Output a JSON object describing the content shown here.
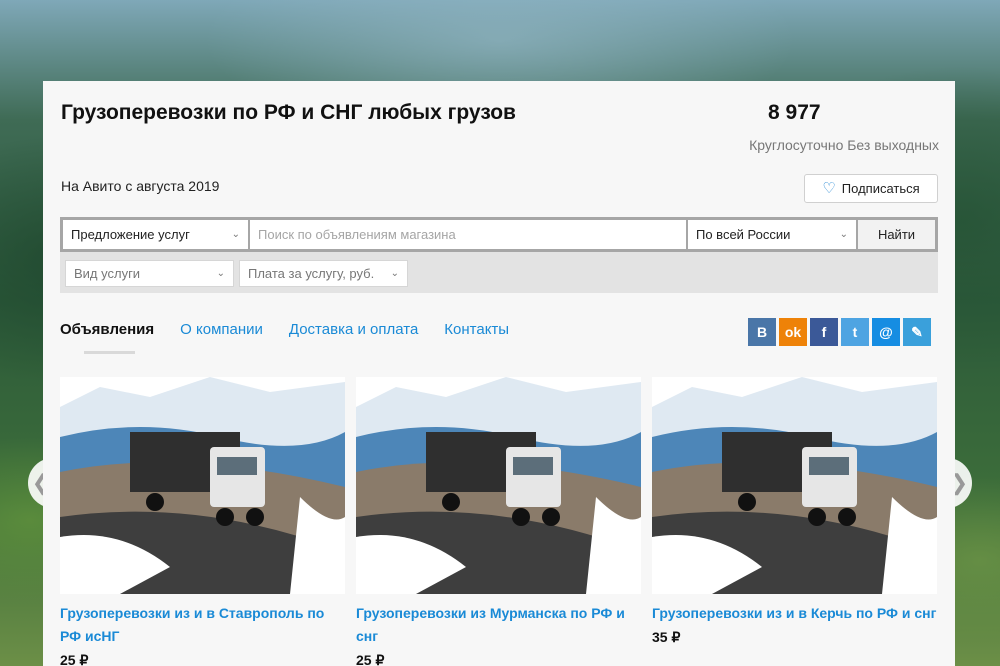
{
  "shop": {
    "title": "Грузоперевозки по РФ и СНГ любых грузов",
    "phone": "8 977",
    "hours": "Круглосуточно Без выходных",
    "since": "На Авито с августа 2019",
    "subscribe_label": "Подписаться"
  },
  "search": {
    "category": "Предложение услуг",
    "query_placeholder": "Поиск по объявлениям магазина",
    "region": "По всей России",
    "find_label": "Найти",
    "service_type": "Вид услуги",
    "price_filter": "Плата за услугу, руб."
  },
  "tabs": [
    {
      "label": "Объявления",
      "active": true
    },
    {
      "label": "О компании",
      "active": false
    },
    {
      "label": "Доставка и оплата",
      "active": false
    },
    {
      "label": "Контакты",
      "active": false
    }
  ],
  "socials": [
    {
      "name": "vk-icon",
      "glyph": "В",
      "color": "#4a76a8"
    },
    {
      "name": "odnoklassniki-icon",
      "glyph": "ok",
      "color": "#ee8208"
    },
    {
      "name": "facebook-icon",
      "glyph": "f",
      "color": "#3b5998"
    },
    {
      "name": "twitter-icon",
      "glyph": "t",
      "color": "#4ea4e2"
    },
    {
      "name": "mail-icon",
      "glyph": "@",
      "color": "#168de2"
    },
    {
      "name": "livejournal-icon",
      "glyph": "✎",
      "color": "#3aa0db"
    }
  ],
  "listings": [
    {
      "title": "Грузоперевозки из и в Ставрополь по РФ исНГ",
      "price": "25 ₽"
    },
    {
      "title": "Грузоперевозки из Мурманска по РФ и снг",
      "price": "25 ₽"
    },
    {
      "title": "Грузоперевозки из и в Керчь по РФ и снг",
      "price": "35 ₽"
    }
  ],
  "nav": {
    "prev_glyph": "❮",
    "next_glyph": "❯"
  }
}
